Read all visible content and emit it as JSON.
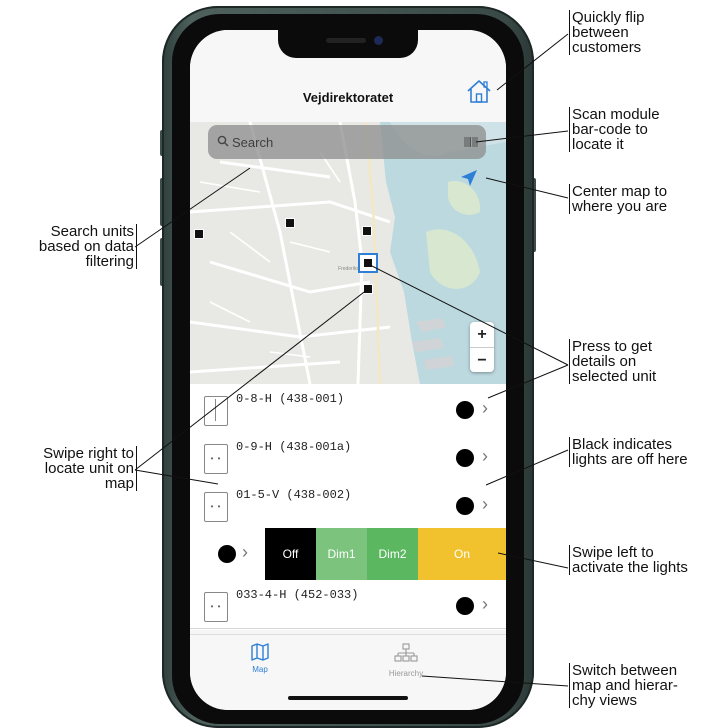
{
  "app": {
    "title": "Vejdirektoratet",
    "search_placeholder": "Search",
    "map_labels": [
      "Frederikshavn"
    ],
    "zoom": {
      "in": "+",
      "out": "−"
    },
    "units": [
      {
        "name": "0-8-H (438-001)",
        "module": "split",
        "light": "off"
      },
      {
        "name": "0-9-H (438-001a)",
        "module": "dots",
        "light": "off"
      },
      {
        "name": "01-5-V (438-002)",
        "module": "dots",
        "light": "off"
      },
      {
        "name": "033-4-H (452-033)",
        "module": "dots",
        "light": "off"
      }
    ],
    "swipe_actions": [
      {
        "label": "Off",
        "color": "#000000"
      },
      {
        "label": "Dim1",
        "color": "#7cc47d"
      },
      {
        "label": "Dim2",
        "color": "#5bb860"
      },
      {
        "label": "On",
        "color": "#f2c12e"
      }
    ],
    "tabs": [
      {
        "label": "Map",
        "icon": "map-icon",
        "active": true
      },
      {
        "label": "Hierarchy",
        "icon": "hierarchy-icon",
        "active": false
      }
    ],
    "colors": {
      "accent": "#2f7fd6",
      "light_off": "#000000",
      "phone_frame": "#3f504c"
    }
  },
  "annotations": {
    "flip_customers": [
      "Quickly flip",
      "between",
      "customers"
    ],
    "scan_barcode": [
      "Scan module",
      "bar-code to",
      "locate it"
    ],
    "center_map": [
      "Center map to",
      "where you are"
    ],
    "search_units": [
      "Search units",
      "based on data",
      "filtering"
    ],
    "press_details": [
      "Press to get",
      "details on",
      "selected unit"
    ],
    "black_off": [
      "Black indicates",
      "lights are off here"
    ],
    "swipe_right": [
      "Swipe right to",
      "locate unit on",
      "map"
    ],
    "swipe_left": [
      "Swipe left to",
      "activate the lights"
    ],
    "switch_views": [
      "Switch between",
      "map and hierar-",
      "chy views"
    ]
  }
}
